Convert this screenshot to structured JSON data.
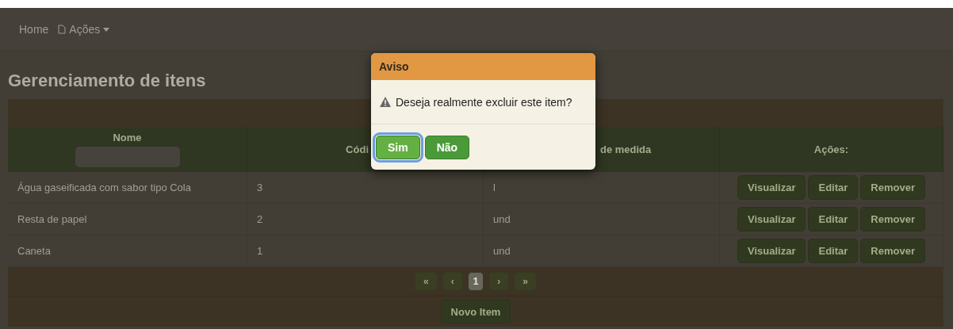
{
  "navbar": {
    "items": [
      {
        "label": "Home",
        "kind": "link"
      },
      {
        "label": "Ações",
        "kind": "dropdown"
      }
    ]
  },
  "page_title": "Gerenciamento de itens",
  "table": {
    "columns": [
      "Nome",
      "Códi",
      "de medida",
      "Ações:"
    ],
    "rows": [
      {
        "cells": [
          "Água gaseificada com sabor tipo Cola",
          "3",
          "l"
        ],
        "actions": [
          "Visualizar",
          "Editar",
          "Remover"
        ]
      },
      {
        "cells": [
          "Resta de papel",
          "2",
          "und"
        ],
        "actions": [
          "Visualizar",
          "Editar",
          "Remover"
        ]
      },
      {
        "cells": [
          "Caneta",
          "1",
          "und"
        ],
        "actions": [
          "Visualizar",
          "Editar",
          "Remover"
        ]
      }
    ]
  },
  "pagination": [
    {
      "label": "«",
      "selected": false
    },
    {
      "label": "‹",
      "selected": false
    },
    {
      "label": "1",
      "selected": true
    },
    {
      "label": "›",
      "selected": false
    },
    {
      "label": "»",
      "selected": false
    }
  ],
  "new_button": "Novo Item",
  "dialog": {
    "title": "Aviso",
    "message": "Deseja realmente excluir este item?",
    "buttons": [
      {
        "label": "Sim",
        "focused": true
      },
      {
        "label": "Não",
        "focused": false
      }
    ]
  }
}
